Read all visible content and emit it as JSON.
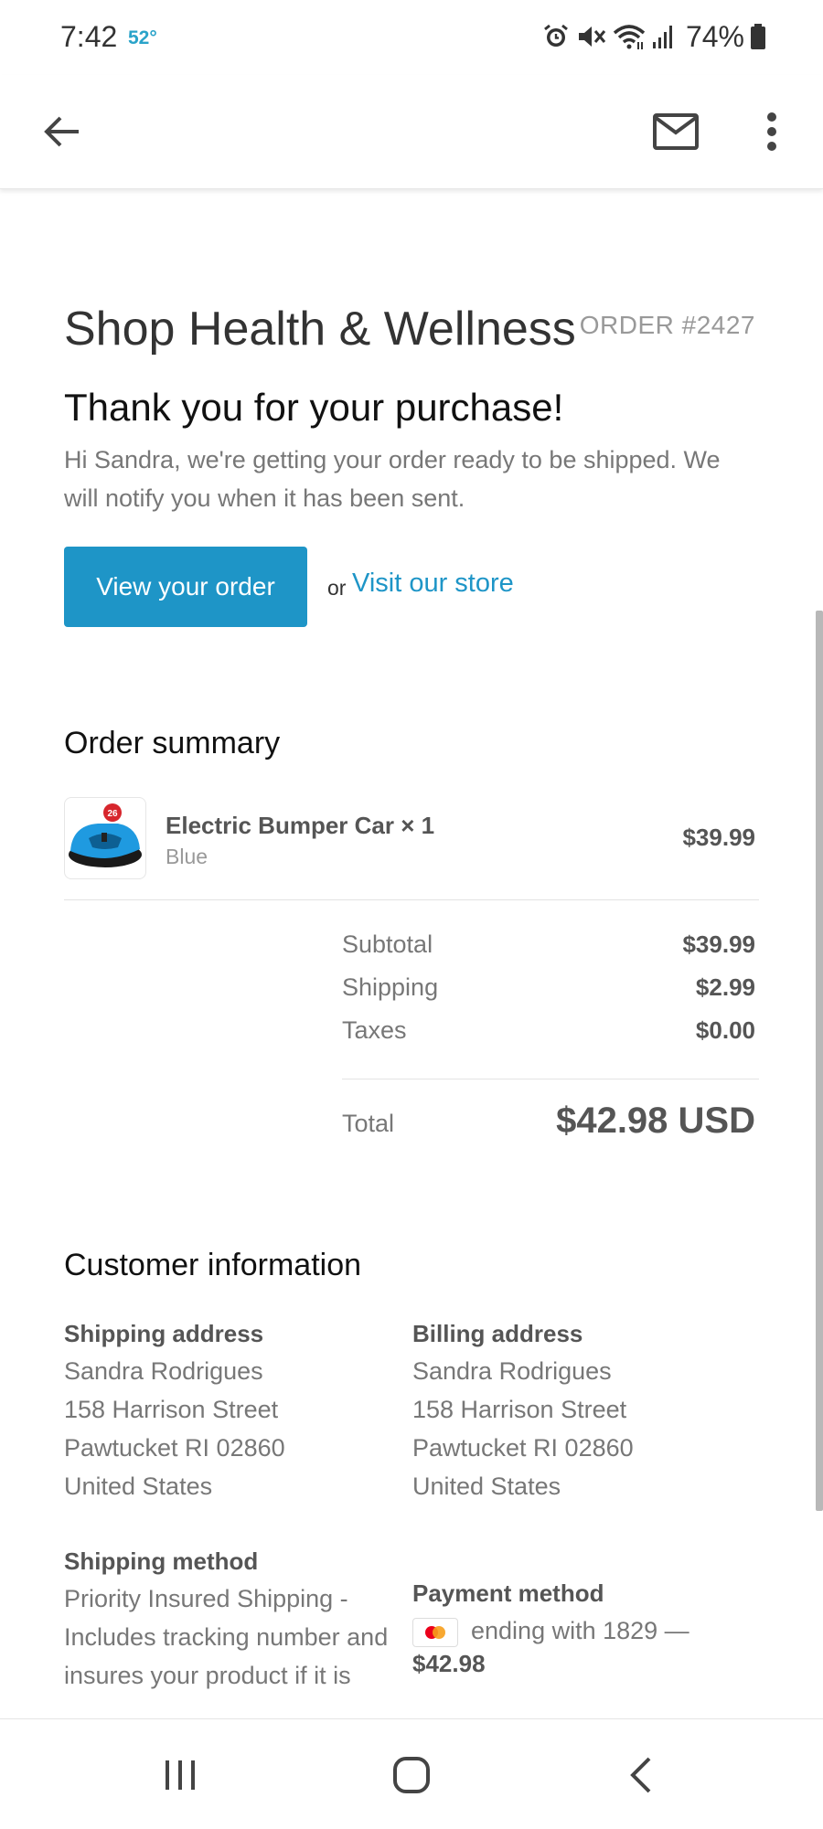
{
  "status_bar": {
    "time": "7:42",
    "temperature": "52°",
    "battery": "74%",
    "icons": [
      "alarm-icon",
      "mute-icon",
      "wifi-icon",
      "signal-icon",
      "battery-icon"
    ]
  },
  "app_bar": {
    "icons": [
      "back-arrow-icon",
      "mail-icon",
      "more-vertical-icon"
    ]
  },
  "email": {
    "shop_title": "Shop Health & Wellness",
    "order_number": "ORDER #2427",
    "thanks_heading": "Thank you for your purchase!",
    "intro_text": "Hi Sandra, we're getting your order ready to be shipped. We will notify you when it has been sent.",
    "view_order_label": "View your order",
    "or_text": "or",
    "visit_store_label": "Visit our store",
    "summary": {
      "title": "Order summary",
      "item": {
        "name": "Electric Bumper Car × 1",
        "variant": "Blue",
        "price": "$39.99",
        "thumb_badge": "26"
      },
      "rows": [
        {
          "label": "Subtotal",
          "value": "$39.99"
        },
        {
          "label": "Shipping",
          "value": "$2.99"
        },
        {
          "label": "Taxes",
          "value": "$0.00"
        }
      ],
      "total_label": "Total",
      "total_value": "$42.98 USD"
    },
    "customer": {
      "title": "Customer information",
      "shipping_address": {
        "heading": "Shipping address",
        "lines": [
          "Sandra Rodrigues",
          "158 Harrison Street",
          "Pawtucket RI 02860",
          "United States"
        ]
      },
      "billing_address": {
        "heading": "Billing address",
        "lines": [
          "Sandra Rodrigues",
          "158 Harrison Street",
          "Pawtucket RI 02860",
          "United States"
        ]
      },
      "shipping_method": {
        "heading": "Shipping method",
        "lines": [
          "Priority Insured Shipping -",
          "Includes tracking number and",
          "insures your product if it is"
        ]
      },
      "payment_method": {
        "heading": "Payment method",
        "card_text": "ending with 1829 —",
        "amount": "$42.98"
      }
    }
  },
  "colors": {
    "accent": "#1e95c7",
    "temperature": "#2aa3c9",
    "muted_text": "#777777",
    "bold_text": "#555555"
  },
  "nav_bar": {
    "icons": [
      "recent-apps-icon",
      "home-icon",
      "back-icon"
    ]
  }
}
